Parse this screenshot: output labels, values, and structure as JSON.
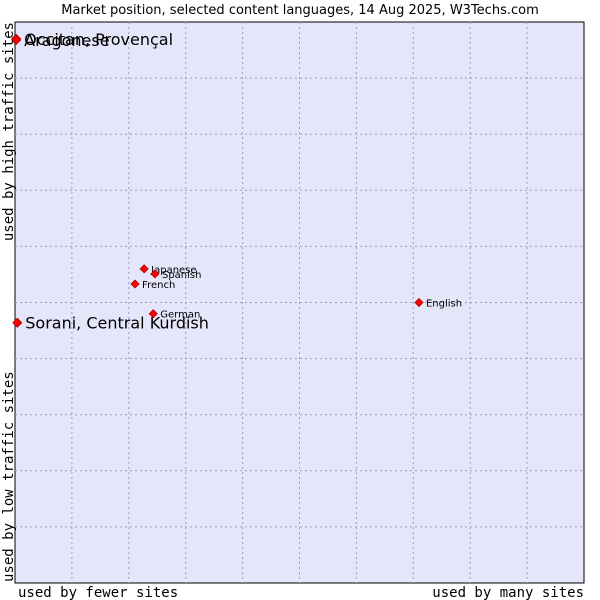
{
  "chart_data": {
    "type": "scatter",
    "title": "Market position, selected content languages, 14 Aug 2025, W3Techs.com",
    "xlabel_left": "used by fewer sites",
    "xlabel_right": "used by many sites",
    "ylabel_bottom": "used by low traffic sites",
    "ylabel_top": "used by high traffic sites",
    "xlim": [
      0,
      1
    ],
    "ylim": [
      0,
      1
    ],
    "grid": true,
    "colors": {
      "plot_background": "#e6e6fa",
      "grid": "#9a9acb",
      "marker": "#ff0000",
      "marker_edge": "#b00000"
    },
    "points": [
      {
        "name": "Occitan, Provençal",
        "x": 0.002,
        "y": 0.97,
        "size": "large"
      },
      {
        "name": "Aragonese",
        "x": 0.002,
        "y": 0.968,
        "size": "large"
      },
      {
        "name": "Sorani, Central Kurdish",
        "x": 0.004,
        "y": 0.464,
        "size": "large"
      },
      {
        "name": "English",
        "x": 0.71,
        "y": 0.5,
        "size": "small"
      },
      {
        "name": "Japanese",
        "x": 0.227,
        "y": 0.56,
        "size": "small"
      },
      {
        "name": "Spanish",
        "x": 0.246,
        "y": 0.551,
        "size": "small"
      },
      {
        "name": "French",
        "x": 0.211,
        "y": 0.533,
        "size": "small"
      },
      {
        "name": "German",
        "x": 0.243,
        "y": 0.48,
        "size": "small"
      }
    ]
  }
}
